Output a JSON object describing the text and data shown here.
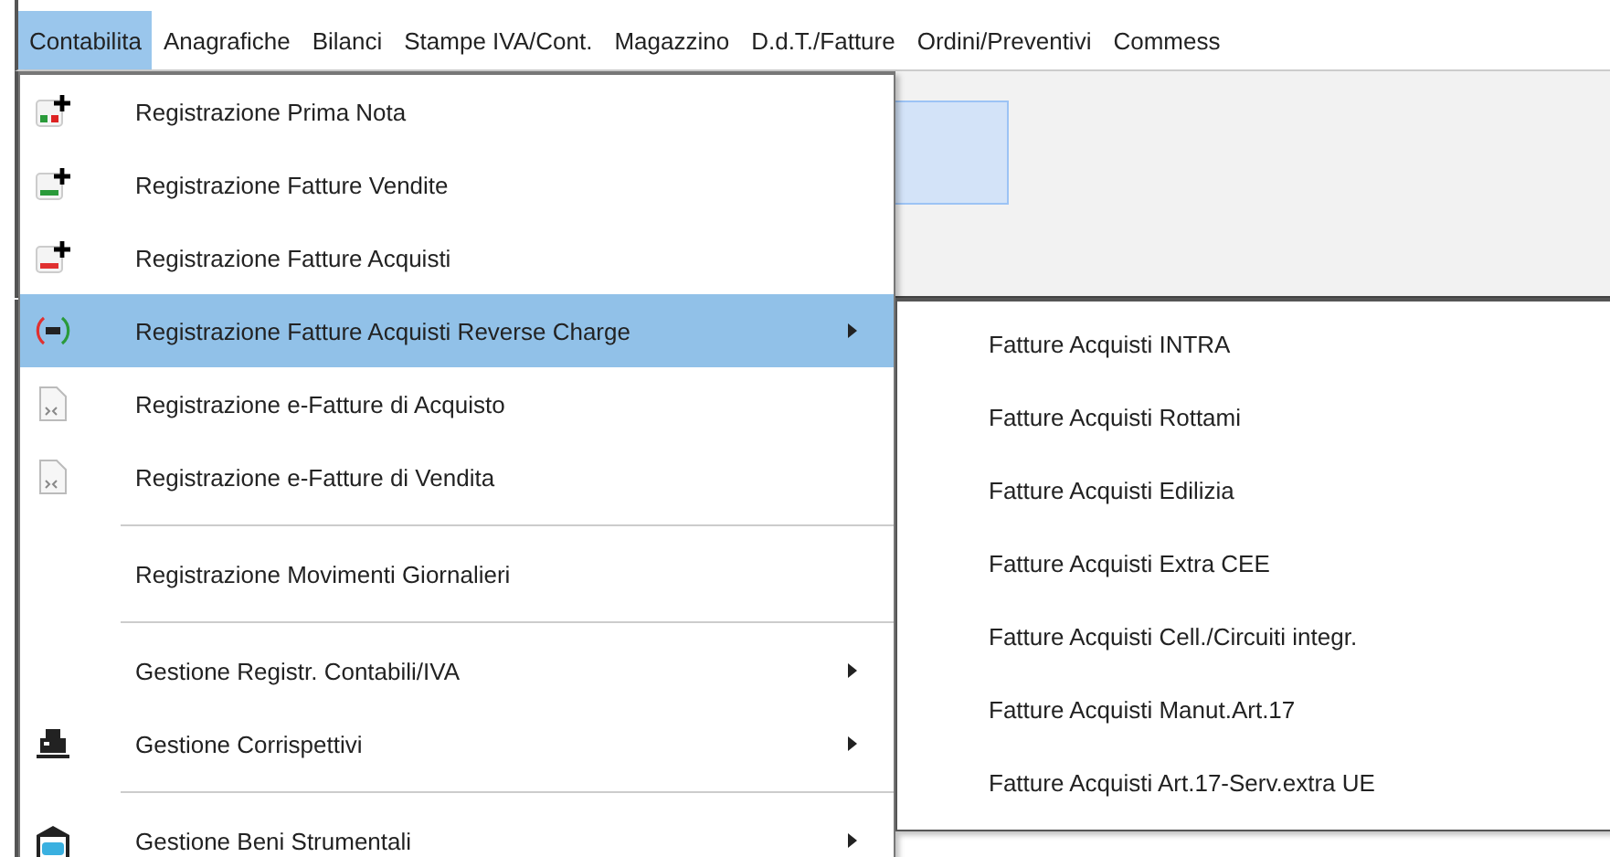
{
  "menubar": [
    {
      "label": "Contabilita",
      "selected": true
    },
    {
      "label": "Anagrafiche",
      "selected": false
    },
    {
      "label": "Bilanci",
      "selected": false
    },
    {
      "label": "Stampe IVA/Cont.",
      "selected": false
    },
    {
      "label": "Magazzino",
      "selected": false
    },
    {
      "label": "D.d.T./Fatture",
      "selected": false
    },
    {
      "label": "Ordini/Preventivi",
      "selected": false
    },
    {
      "label": "Commess",
      "selected": false
    }
  ],
  "menu": [
    {
      "kind": "item",
      "label": "Registrazione Prima Nota",
      "selected": false,
      "submenu": false
    },
    {
      "kind": "item",
      "label": "Registrazione Fatture Vendite",
      "selected": false,
      "submenu": false
    },
    {
      "kind": "item",
      "label": "Registrazione Fatture Acquisti",
      "selected": false,
      "submenu": false
    },
    {
      "kind": "item",
      "label": "Registrazione Fatture Acquisti Reverse Charge",
      "selected": true,
      "submenu": true
    },
    {
      "kind": "item",
      "label": "Registrazione e-Fatture di Acquisto",
      "selected": false,
      "submenu": false
    },
    {
      "kind": "item",
      "label": "Registrazione e-Fatture di Vendita",
      "selected": false,
      "submenu": false
    },
    {
      "kind": "separator"
    },
    {
      "kind": "item",
      "label": "Registrazione Movimenti Giornalieri",
      "selected": false,
      "submenu": false
    },
    {
      "kind": "separator"
    },
    {
      "kind": "item",
      "label": "Gestione Registr. Contabili/IVA",
      "selected": false,
      "submenu": true
    },
    {
      "kind": "item",
      "label": "Gestione Corrispettivi",
      "selected": false,
      "submenu": true
    },
    {
      "kind": "separator"
    },
    {
      "kind": "item",
      "label": "Gestione Beni Strumentali",
      "selected": false,
      "submenu": true
    }
  ],
  "submenu": [
    {
      "label": "Fatture Acquisti INTRA"
    },
    {
      "label": "Fatture Acquisti Rottami"
    },
    {
      "label": "Fatture Acquisti Edilizia"
    },
    {
      "label": "Fatture Acquisti Extra CEE"
    },
    {
      "label": "Fatture Acquisti Cell./Circuiti integr."
    },
    {
      "label": "Fatture Acquisti Manut.Art.17"
    },
    {
      "label": "Fatture Acquisti Art.17-Serv.extra UE"
    }
  ]
}
